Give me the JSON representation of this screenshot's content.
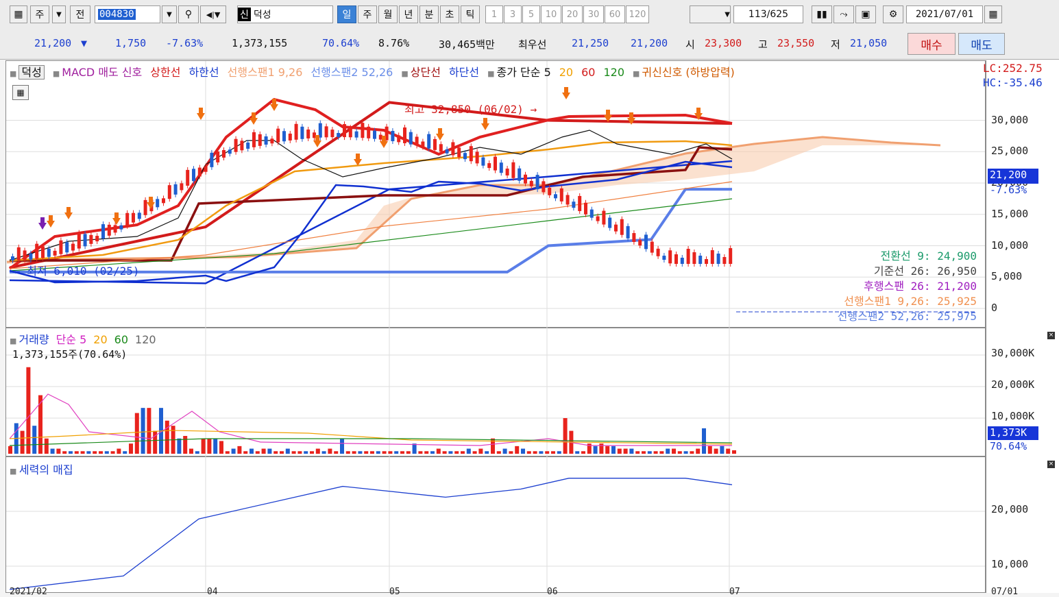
{
  "toolbar": {
    "type_label": "주",
    "prev_label": "전",
    "code": "004830",
    "sin_label": "신",
    "name": "덕성",
    "periods": [
      "일",
      "주",
      "월",
      "년",
      "분",
      "초",
      "틱"
    ],
    "minutes": [
      "1",
      "3",
      "5",
      "10",
      "20",
      "30",
      "60",
      "120"
    ],
    "count": "113",
    "total": "/625",
    "date": "2021/07/01"
  },
  "quote": {
    "price": "21,200",
    "arrow": "▼",
    "change": "1,750",
    "change_pct": "-7.63%",
    "volume": "1,373,155",
    "vol_ratio": "70.64%",
    "turnover": "8.76%",
    "amount": "30,465백만",
    "best_label": "최우선",
    "best_ask": "21,250",
    "best_bid": "21,200",
    "open_label": "시",
    "open": "23,300",
    "high_label": "고",
    "high": "23,550",
    "low_label": "저",
    "low": "21,050",
    "buy_label": "매수",
    "sell_label": "매도"
  },
  "price_panel": {
    "legend": [
      {
        "text": "덕성",
        "color": "#111111"
      },
      {
        "text": "MACD 매도 신호",
        "color": "#a0209e"
      },
      {
        "text": "상한선",
        "color": "#d21b1b"
      },
      {
        "text": "하한선",
        "color": "#1c3fcf"
      },
      {
        "text": "선행스팬1 9,26",
        "color": "#f0a070"
      },
      {
        "text": "선행스팬2 52,26",
        "color": "#6a8ee8"
      },
      {
        "text": "상단선",
        "color": "#a01010"
      },
      {
        "text": "하단선",
        "color": "#1c3fcf"
      },
      {
        "text": "종가 단순 5",
        "color": "#111111"
      },
      {
        "text": "20",
        "color": "#f0a000"
      },
      {
        "text": "60",
        "color": "#d21b1b"
      },
      {
        "text": "120",
        "color": "#1a8a1a"
      },
      {
        "text": "귀신신호 (하방압력)",
        "color": "#d05a00"
      }
    ],
    "lc": "LC:252.75",
    "hc": "HC:-35.46",
    "high_note": "최고 32,850 (06/02) →",
    "low_note": "← 최저 6,010 (02/25)",
    "ichimoku": [
      {
        "text": "전환선 9: 24,900",
        "color": "#1a9a6a"
      },
      {
        "text": "기준선 26: 26,950",
        "color": "#444444"
      },
      {
        "text": "후행스팬 26: 21,200",
        "color": "#a020c0"
      },
      {
        "text": "선행스팬1 9,26: 25,925",
        "color": "#f09050"
      },
      {
        "text": "선행스팬2 52,26: 25,975",
        "color": "#5a7ee0"
      }
    ],
    "ticks": [
      "30,000",
      "25,000",
      "20,000",
      "15,000",
      "10,000",
      "5,000",
      "0"
    ],
    "price_tag": "21,200",
    "pct_tag": "-7.63%"
  },
  "volume_panel": {
    "legend": [
      {
        "text": "거래량",
        "color": "#1c3fcf"
      },
      {
        "text": "단순 5",
        "color": "#d020c0"
      },
      {
        "text": "20",
        "color": "#f0a000"
      },
      {
        "text": "60",
        "color": "#1a8a1a"
      },
      {
        "text": "120",
        "color": "#666666"
      }
    ],
    "current": "1,373,155주(70.64%)",
    "ticks": [
      "30,000K",
      "20,000K",
      "10,000K"
    ],
    "tag": "1,373K",
    "tag_pct": "70.64%"
  },
  "power_panel": {
    "legend": "세력의 매집",
    "ticks": [
      "20,000",
      "10,000"
    ]
  },
  "dates": [
    "2021/02",
    "04",
    "05",
    "06",
    "07"
  ],
  "last_date": "07/01",
  "colors": {
    "up": "#e8231d",
    "down": "#1f5fd0",
    "accent": "#3b82d6"
  },
  "chart_data": [
    {
      "type": "line",
      "title": "",
      "y_range": [
        0,
        33000
      ],
      "x": [
        "2021/02",
        "04",
        "05",
        "06",
        "07"
      ],
      "series": [
        {
          "name": "상한선",
          "values": [
            6500,
            13000,
            32850,
            30000,
            29500
          ]
        },
        {
          "name": "하한선",
          "values": [
            4500,
            4000,
            19000,
            21000,
            23500
          ]
        },
        {
          "name": "선행스팬2 52,26",
          "values": [
            5800,
            5800,
            5800,
            12000,
            25975
          ]
        }
      ]
    },
    {
      "type": "bar",
      "title": "거래량",
      "y_range": [
        0,
        35000
      ],
      "unit": "K",
      "last_value": 1373
    },
    {
      "type": "line",
      "title": "세력의 매집",
      "y_range": [
        6000,
        28000
      ],
      "series": [
        {
          "name": "세력의 매집",
          "values": [
            6500,
            9000,
            19500,
            25500,
            23500,
            25000,
            27000,
            27000,
            25800
          ]
        }
      ]
    }
  ]
}
